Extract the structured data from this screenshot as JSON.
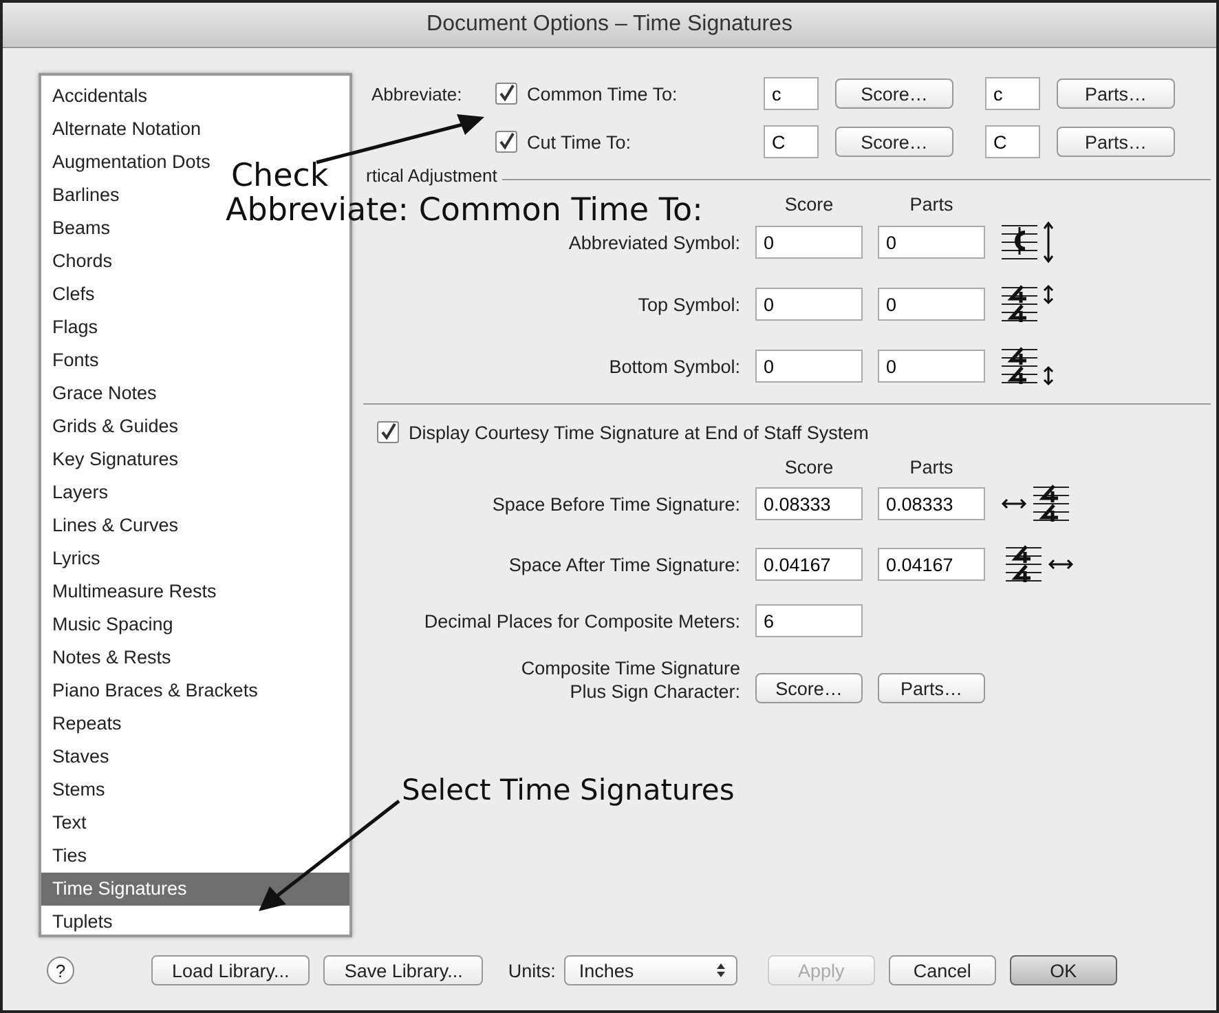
{
  "window": {
    "title": "Document Options – Time Signatures"
  },
  "sidebar": {
    "items": [
      {
        "label": "Accidentals",
        "selected": false
      },
      {
        "label": "Alternate Notation",
        "selected": false
      },
      {
        "label": "Augmentation Dots",
        "selected": false
      },
      {
        "label": "Barlines",
        "selected": false
      },
      {
        "label": "Beams",
        "selected": false
      },
      {
        "label": "Chords",
        "selected": false
      },
      {
        "label": "Clefs",
        "selected": false
      },
      {
        "label": "Flags",
        "selected": false
      },
      {
        "label": "Fonts",
        "selected": false
      },
      {
        "label": "Grace Notes",
        "selected": false
      },
      {
        "label": "Grids & Guides",
        "selected": false
      },
      {
        "label": "Key Signatures",
        "selected": false
      },
      {
        "label": "Layers",
        "selected": false
      },
      {
        "label": "Lines & Curves",
        "selected": false
      },
      {
        "label": "Lyrics",
        "selected": false
      },
      {
        "label": "Multimeasure Rests",
        "selected": false
      },
      {
        "label": "Music Spacing",
        "selected": false
      },
      {
        "label": "Notes & Rests",
        "selected": false
      },
      {
        "label": "Piano Braces & Brackets",
        "selected": false
      },
      {
        "label": "Repeats",
        "selected": false
      },
      {
        "label": "Staves",
        "selected": false
      },
      {
        "label": "Stems",
        "selected": false
      },
      {
        "label": "Text",
        "selected": false
      },
      {
        "label": "Ties",
        "selected": false
      },
      {
        "label": "Time Signatures",
        "selected": true
      },
      {
        "label": "Tuplets",
        "selected": false
      }
    ]
  },
  "abbreviate": {
    "label": "Abbreviate:",
    "rows": [
      {
        "label": "Common Time To:",
        "checked": true,
        "score_value": "c",
        "score_button": "Score…",
        "parts_value": "c",
        "parts_button": "Parts…"
      },
      {
        "label": "Cut Time To:",
        "checked": true,
        "score_value": "C",
        "score_button": "Score…",
        "parts_value": "C",
        "parts_button": "Parts…"
      }
    ]
  },
  "vertical_adjustment": {
    "title": "rtical Adjustment",
    "columns": [
      "Score",
      "Parts"
    ],
    "rows": [
      {
        "label": "Abbreviated Symbol:",
        "score": "0",
        "parts": "0",
        "kind": "common"
      },
      {
        "label": "Top Symbol:",
        "score": "0",
        "parts": "0",
        "kind": "top"
      },
      {
        "label": "Bottom Symbol:",
        "score": "0",
        "parts": "0",
        "kind": "bottom"
      }
    ]
  },
  "courtesy": {
    "label": "Display Courtesy Time Signature at End of Staff System",
    "checked": true,
    "columns": [
      "Score",
      "Parts"
    ],
    "rows": [
      {
        "label": "Space Before Time Signature:",
        "score": "0.08333",
        "parts": "0.08333",
        "kind": "before"
      },
      {
        "label": "Space After Time Signature:",
        "score": "0.04167",
        "parts": "0.04167",
        "kind": "after"
      }
    ]
  },
  "decimal_places": {
    "label": "Decimal Places for Composite Meters:",
    "value": "6"
  },
  "composite": {
    "label": "Composite Time Signature\nPlus Sign Character:",
    "buttons": [
      "Score…",
      "Parts…"
    ]
  },
  "footer": {
    "help": "?",
    "load": "Load Library...",
    "save": "Save Library...",
    "units_label": "Units:",
    "units_value": "Inches",
    "buttons": [
      {
        "label": "Apply",
        "disabled": true,
        "default": false
      },
      {
        "label": "Cancel",
        "disabled": false,
        "default": false
      },
      {
        "label": "OK",
        "disabled": false,
        "default": true
      }
    ]
  },
  "annotations": [
    {
      "lines": [
        "Check",
        "Abbreviate: Common Time To:"
      ]
    },
    {
      "lines": [
        "Select Time Signatures"
      ]
    }
  ]
}
